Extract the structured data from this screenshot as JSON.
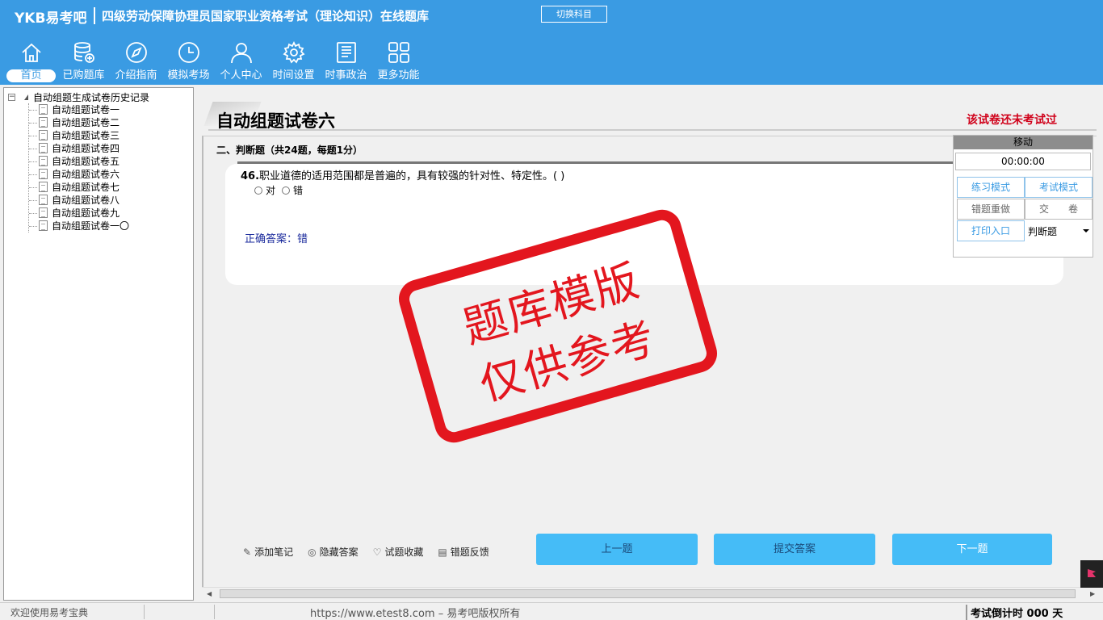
{
  "header": {
    "logo": "YKB易考吧",
    "title": "四级劳动保障协理员国家职业资格考试（理论知识）在线题库",
    "switch_label": "切换科目"
  },
  "nav": {
    "items": [
      {
        "label": "首页",
        "icon": "home-icon"
      },
      {
        "label": "已购题库",
        "icon": "database-icon"
      },
      {
        "label": "介绍指南",
        "icon": "compass-icon"
      },
      {
        "label": "模拟考场",
        "icon": "clock-icon"
      },
      {
        "label": "个人中心",
        "icon": "user-icon"
      },
      {
        "label": "时间设置",
        "icon": "gear-icon"
      },
      {
        "label": "时事政治",
        "icon": "newspaper-icon"
      },
      {
        "label": "更多功能",
        "icon": "grid-icon"
      }
    ]
  },
  "tree": {
    "root": "自动组题生成试卷历史记录",
    "items": [
      "自动组题试卷一",
      "自动组题试卷二",
      "自动组题试卷三",
      "自动组题试卷四",
      "自动组题试卷五",
      "自动组题试卷六",
      "自动组题试卷七",
      "自动组题试卷八",
      "自动组题试卷九",
      "自动组题试卷一〇"
    ]
  },
  "paper": {
    "title": "自动组题试卷六",
    "status": "该试卷还未考试过",
    "section": "二、判断题（共24题，每题1分）",
    "question_no": "46.",
    "question": "职业道德的适用范围都是普遍的，具有较强的针对性、特定性。( )",
    "options": [
      "对",
      "错"
    ],
    "answer": "正确答案：错"
  },
  "stamp": {
    "line1": "题库模版",
    "line2": "仅供参考"
  },
  "side": {
    "move": "移动",
    "timer": "00:00:00",
    "practice": "练习模式",
    "exam": "考试模式",
    "redo": "错题重做",
    "submit": "交　　卷",
    "print": "打印入口",
    "type": "判断题"
  },
  "tools": {
    "note": "添加笔记",
    "hide": "隐藏答案",
    "fav": "试题收藏",
    "feedback": "错题反馈"
  },
  "buttons": {
    "prev": "上一题",
    "submit_answer": "提交答案",
    "next": "下一题"
  },
  "status": {
    "welcome": "欢迎使用易考宝典",
    "copyright": "https://www.etest8.com – 易考吧版权所有",
    "countdown": "考试倒计时 000 天"
  },
  "colors": {
    "header": "#3a9be3",
    "button": "#45bcf7",
    "stamp": "#e3161e"
  }
}
